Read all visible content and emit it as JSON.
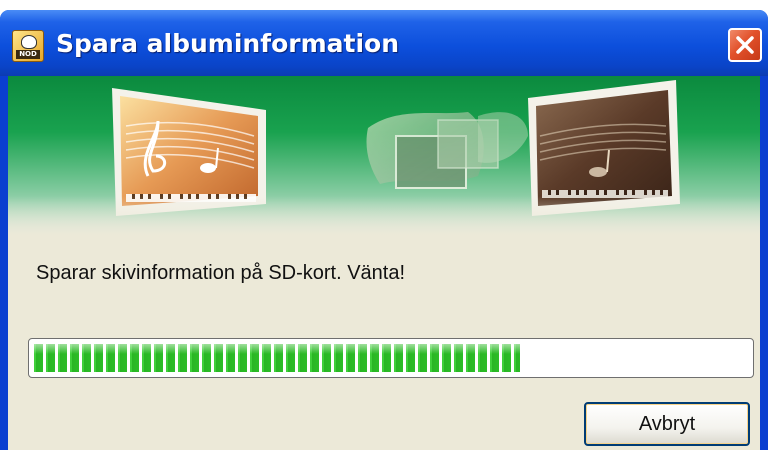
{
  "window": {
    "title": "Spara albuminformation",
    "app_icon": "app-mascot-icon",
    "close_icon": "close-icon",
    "app_icon_tag": "NOD"
  },
  "banner": {
    "images": [
      "music-sheet-card-icon",
      "transfer-icon",
      "music-sheet-card-dark-icon"
    ]
  },
  "status": {
    "message": "Sparar skivinformation på SD-kort. Vänta!"
  },
  "progress": {
    "value": 0.68
  },
  "buttons": {
    "cancel_label": "Avbryt"
  },
  "colors": {
    "titlebar": "#0a44c8",
    "client_bg": "#ece9d8",
    "progress_green": "#2cbc27",
    "banner_green": "#0b8a3e",
    "close_red": "#e2512b"
  }
}
